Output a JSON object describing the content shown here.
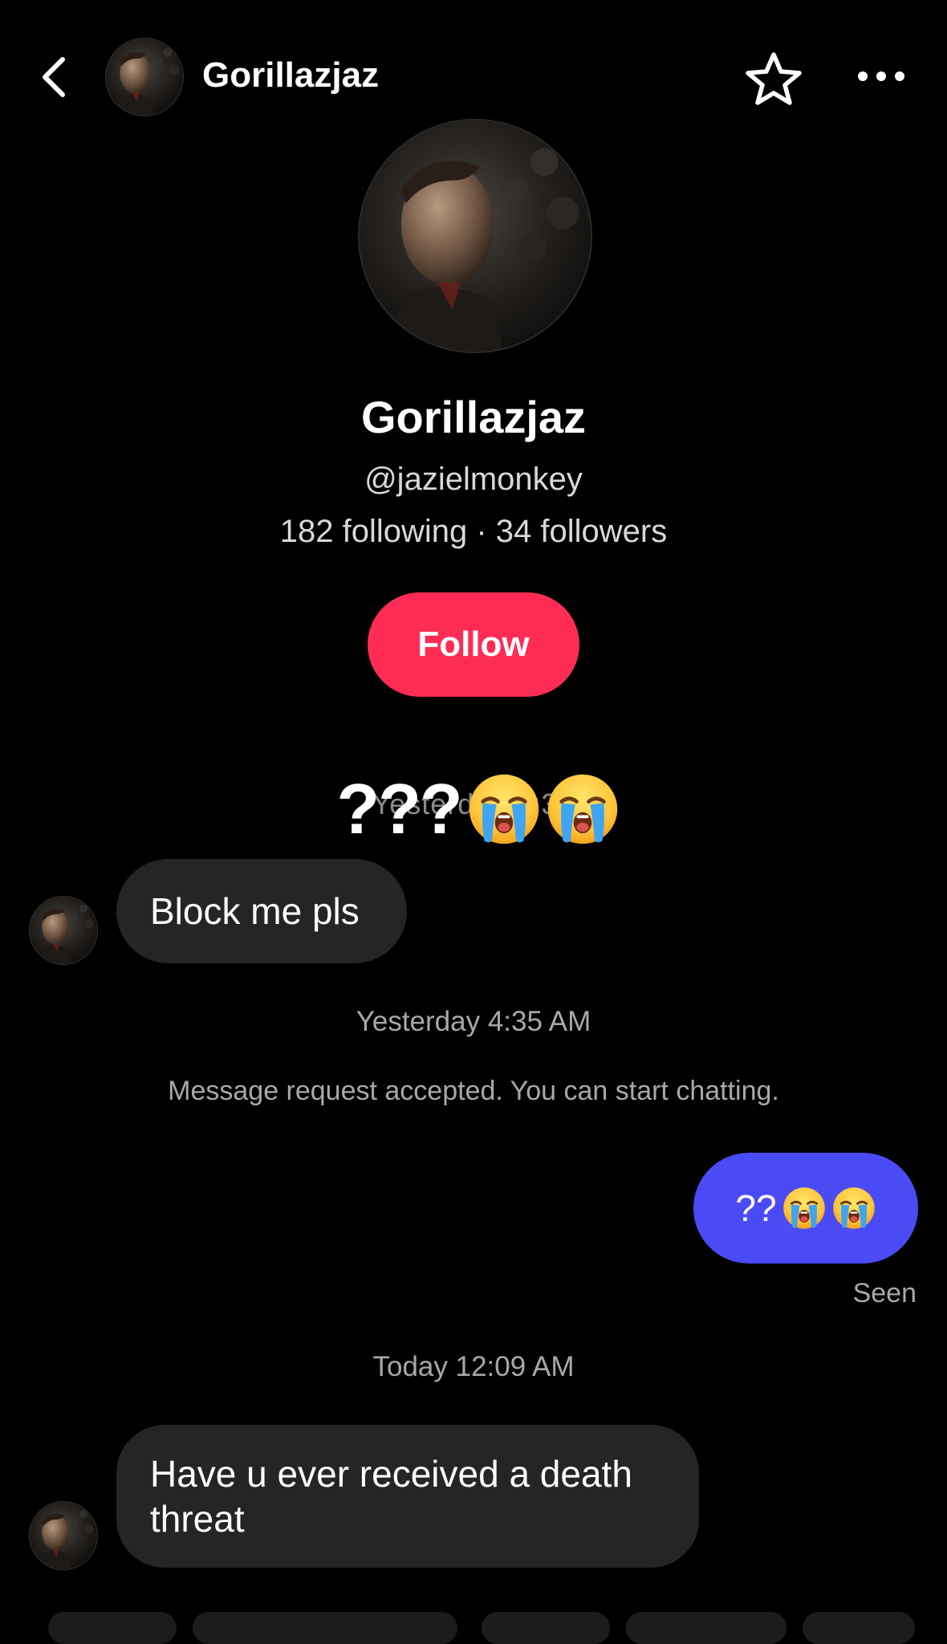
{
  "header": {
    "title": "Gorillazjaz",
    "back_icon": "chevron-left-icon",
    "favorite_icon": "star-outline-icon",
    "more_icon": "more-horizontal-icon"
  },
  "profile": {
    "name": "Gorillazjaz",
    "handle": "@jazielmonkey",
    "stats": "182 following · 34 followers",
    "follow_label": "Follow"
  },
  "colors": {
    "follow": "#fe2c55",
    "outgoing_bubble": "#4b4bf5",
    "incoming_bubble": "#252525"
  },
  "messages": {
    "overlap_timestamp": "Yesterday 4:33",
    "overlap_text": "???",
    "overlap_emoji": "loudly-crying-face ×2",
    "incoming_1": "Block me pls",
    "timestamp_1": "Yesterday 4:35 AM",
    "system_notice": "Message request accepted. You can start chatting.",
    "outgoing_1": "??",
    "outgoing_1_emoji": "loudly-crying-face ×2",
    "seen_label": "Seen",
    "timestamp_2": "Today 12:09 AM",
    "incoming_2": "Have u ever received a death threat"
  }
}
